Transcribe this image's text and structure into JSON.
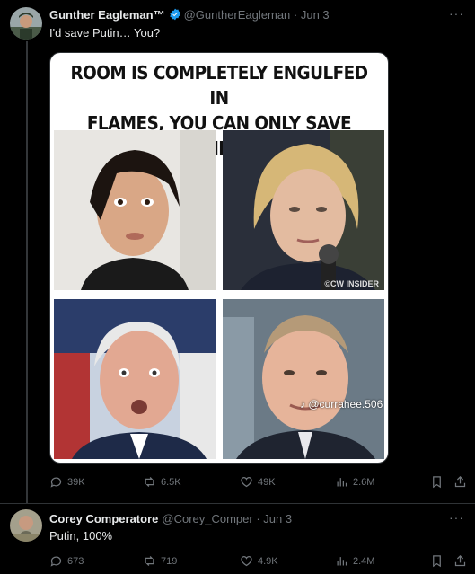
{
  "tweet1": {
    "name": "Gunther Eagleman™",
    "handle": "@GuntherEagleman",
    "date": "Jun 3",
    "text": "I'd save Putin…  You?",
    "more": "···",
    "media": {
      "headline_line1": "ROOM IS COMPLETELY ENGULFED IN",
      "headline_line2": "FLAMES, YOU CAN ONLY SAVE ONE...",
      "watermark": "©CW INSIDER",
      "tiktok_tag": "@currahee.506"
    },
    "stats": {
      "replies": "39K",
      "retweets": "6.5K",
      "likes": "49K",
      "views": "2.6M"
    }
  },
  "tweet2": {
    "name": "Corey Comperatore",
    "handle": "@Corey_Comper",
    "date": "Jun 3",
    "text": "Putin, 100%",
    "more": "···",
    "stats": {
      "replies": "673",
      "retweets": "719",
      "likes": "4.9K",
      "views": "2.4M"
    }
  },
  "colors": {
    "background": "#000000",
    "muted": "#71767b",
    "verified": "#1d9bf0",
    "divider": "#2f3336"
  }
}
